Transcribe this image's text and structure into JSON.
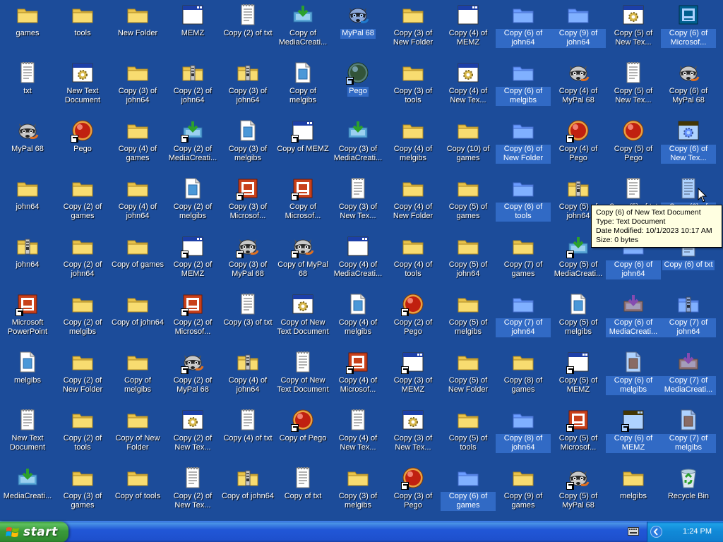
{
  "desktop": {
    "icons": [
      {
        "label": "games",
        "type": "folder",
        "col": 0,
        "row": 0
      },
      {
        "label": "tools",
        "type": "folder",
        "col": 1,
        "row": 0
      },
      {
        "label": "New Folder",
        "type": "folder",
        "col": 2,
        "row": 0
      },
      {
        "label": "MEMZ",
        "type": "window",
        "col": 3,
        "row": 0
      },
      {
        "label": "Copy (2) of txt",
        "type": "text",
        "col": 4,
        "row": 0
      },
      {
        "label": "Copy of MediaCreati...",
        "type": "media",
        "col": 5,
        "row": 0
      },
      {
        "label": "MyPal 68",
        "type": "raccoon",
        "col": 6,
        "row": 0,
        "selected": true
      },
      {
        "label": "Copy (3) of New Folder",
        "type": "folder",
        "col": 7,
        "row": 0
      },
      {
        "label": "Copy (4) of MEMZ",
        "type": "window",
        "col": 8,
        "row": 0
      },
      {
        "label": "Copy (6) of john64",
        "type": "folder",
        "col": 9,
        "row": 0,
        "selected": true
      },
      {
        "label": "Copy (9) of john64",
        "type": "folder",
        "col": 10,
        "row": 0,
        "selected": true
      },
      {
        "label": "Copy (5) of New Tex...",
        "type": "gear",
        "col": 11,
        "row": 0
      },
      {
        "label": "Copy (6) of Microsof...",
        "type": "ppt",
        "col": 12,
        "row": 0,
        "selected": true
      },
      {
        "label": "txt",
        "type": "text",
        "col": 0,
        "row": 1
      },
      {
        "label": "New Text Document",
        "type": "gear",
        "col": 1,
        "row": 1
      },
      {
        "label": "Copy (3) of john64",
        "type": "folder",
        "col": 2,
        "row": 1
      },
      {
        "label": "Copy (2) of john64",
        "type": "zip",
        "col": 3,
        "row": 1
      },
      {
        "label": "Copy (3) of john64",
        "type": "zip",
        "col": 4,
        "row": 1
      },
      {
        "label": "Copy of melgibs",
        "type": "image",
        "col": 5,
        "row": 1
      },
      {
        "label": "Pego",
        "type": "purpleball",
        "col": 6,
        "row": 1,
        "shortcut": true,
        "selected": true
      },
      {
        "label": "Copy (3) of tools",
        "type": "folder",
        "col": 7,
        "row": 1
      },
      {
        "label": "Copy (4) of New Tex...",
        "type": "gear",
        "col": 8,
        "row": 1
      },
      {
        "label": "Copy (6) of melgibs",
        "type": "folder",
        "col": 9,
        "row": 1,
        "selected": true
      },
      {
        "label": "Copy (4) of MyPal 68",
        "type": "raccoon",
        "col": 10,
        "row": 1
      },
      {
        "label": "Copy (5) of New Tex...",
        "type": "text",
        "col": 11,
        "row": 1
      },
      {
        "label": "Copy (6) of MyPal 68",
        "type": "raccoon",
        "col": 12,
        "row": 1
      },
      {
        "label": "MyPal 68",
        "type": "raccoon",
        "col": 0,
        "row": 2
      },
      {
        "label": "Pego",
        "type": "ball",
        "col": 1,
        "row": 2,
        "shortcut": true
      },
      {
        "label": "Copy (4) of games",
        "type": "folder",
        "col": 2,
        "row": 2
      },
      {
        "label": "Copy (2) of MediaCreati...",
        "type": "media",
        "col": 3,
        "row": 2,
        "shortcut": true
      },
      {
        "label": "Copy (3) of melgibs",
        "type": "image",
        "col": 4,
        "row": 2
      },
      {
        "label": "Copy of MEMZ",
        "type": "window",
        "col": 5,
        "row": 2,
        "shortcut": true
      },
      {
        "label": "Copy (3) of MediaCreati...",
        "type": "media",
        "col": 6,
        "row": 2
      },
      {
        "label": "Copy (4) of melgibs",
        "type": "folder",
        "col": 7,
        "row": 2
      },
      {
        "label": "Copy (10) of games",
        "type": "folder",
        "col": 8,
        "row": 2
      },
      {
        "label": "Copy (6) of New Folder",
        "type": "folder",
        "col": 9,
        "row": 2,
        "selected": true
      },
      {
        "label": "Copy (4) of Pego",
        "type": "ball",
        "col": 10,
        "row": 2,
        "shortcut": true
      },
      {
        "label": "Copy (5) of Pego",
        "type": "ball",
        "col": 11,
        "row": 2
      },
      {
        "label": "Copy (6) of New Tex...",
        "type": "gear",
        "col": 12,
        "row": 2,
        "selected": true
      },
      {
        "label": "john64",
        "type": "folder",
        "col": 0,
        "row": 3
      },
      {
        "label": "Copy (2) of games",
        "type": "folder",
        "col": 1,
        "row": 3
      },
      {
        "label": "Copy (4) of john64",
        "type": "folder",
        "col": 2,
        "row": 3
      },
      {
        "label": "Copy (2) of melgibs",
        "type": "image",
        "col": 3,
        "row": 3
      },
      {
        "label": "Copy (3) of Microsof...",
        "type": "ppt",
        "col": 4,
        "row": 3,
        "shortcut": true
      },
      {
        "label": "Copy of Microsof...",
        "type": "ppt",
        "col": 5,
        "row": 3,
        "shortcut": true
      },
      {
        "label": "Copy (3) of New Tex...",
        "type": "text",
        "col": 6,
        "row": 3
      },
      {
        "label": "Copy (4) of New Folder",
        "type": "folder",
        "col": 7,
        "row": 3
      },
      {
        "label": "Copy (5) of games",
        "type": "folder",
        "col": 8,
        "row": 3
      },
      {
        "label": "Copy (6) of tools",
        "type": "folder",
        "col": 9,
        "row": 3,
        "selected": true
      },
      {
        "label": "Copy (5) of john64",
        "type": "zip",
        "col": 10,
        "row": 3
      },
      {
        "label": "Copy (5) of txt",
        "type": "text",
        "col": 11,
        "row": 3
      },
      {
        "label": "Copy (6) of New Text Document",
        "type": "text",
        "col": 12,
        "row": 3,
        "selected": true
      },
      {
        "label": "john64",
        "type": "zip",
        "col": 0,
        "row": 4
      },
      {
        "label": "Copy (2) of john64",
        "type": "folder",
        "col": 1,
        "row": 4
      },
      {
        "label": "Copy of games",
        "type": "folder",
        "col": 2,
        "row": 4
      },
      {
        "label": "Copy (2) of MEMZ",
        "type": "window",
        "col": 3,
        "row": 4,
        "shortcut": true
      },
      {
        "label": "Copy (3) of MyPal 68",
        "type": "raccoon",
        "col": 4,
        "row": 4,
        "shortcut": true
      },
      {
        "label": "Copy of MyPal 68",
        "type": "raccoon",
        "col": 5,
        "row": 4,
        "shortcut": true
      },
      {
        "label": "Copy (4) of MediaCreati...",
        "type": "window",
        "col": 6,
        "row": 4
      },
      {
        "label": "Copy (4) of tools",
        "type": "folder",
        "col": 7,
        "row": 4
      },
      {
        "label": "Copy (5) of john64",
        "type": "folder",
        "col": 8,
        "row": 4
      },
      {
        "label": "Copy (7) of games",
        "type": "folder",
        "col": 9,
        "row": 4
      },
      {
        "label": "Copy (5) of MediaCreati...",
        "type": "media",
        "col": 10,
        "row": 4,
        "shortcut": true
      },
      {
        "label": "Copy (6) of john64",
        "type": "folder",
        "col": 11,
        "row": 4,
        "selected": true
      },
      {
        "label": "Copy (6) of txt",
        "type": "text",
        "col": 12,
        "row": 4,
        "selected": true
      },
      {
        "label": "Microsoft PowerPoint",
        "type": "ppt",
        "col": 0,
        "row": 5,
        "shortcut": true
      },
      {
        "label": "Copy (2) of melgibs",
        "type": "folder",
        "col": 1,
        "row": 5
      },
      {
        "label": "Copy of john64",
        "type": "folder",
        "col": 2,
        "row": 5
      },
      {
        "label": "Copy (2) of Microsof...",
        "type": "ppt",
        "col": 3,
        "row": 5,
        "shortcut": true
      },
      {
        "label": "Copy (3) of txt",
        "type": "text",
        "col": 4,
        "row": 5
      },
      {
        "label": "Copy of New Text Document",
        "type": "gear",
        "col": 5,
        "row": 5
      },
      {
        "label": "Copy (4) of melgibs",
        "type": "image",
        "col": 6,
        "row": 5
      },
      {
        "label": "Copy (2) of Pego",
        "type": "ball",
        "col": 7,
        "row": 5,
        "shortcut": true
      },
      {
        "label": "Copy (5) of melgibs",
        "type": "folder",
        "col": 8,
        "row": 5
      },
      {
        "label": "Copy (7) of john64",
        "type": "folder",
        "col": 9,
        "row": 5,
        "selected": true
      },
      {
        "label": "Copy (5) of melgibs",
        "type": "image",
        "col": 10,
        "row": 5
      },
      {
        "label": "Copy (6) of MediaCreati...",
        "type": "media",
        "col": 11,
        "row": 5,
        "selected": true
      },
      {
        "label": "Copy (7) of john64",
        "type": "zip",
        "col": 12,
        "row": 5,
        "selected": true
      },
      {
        "label": "melgibs",
        "type": "image",
        "col": 0,
        "row": 6
      },
      {
        "label": "Copy (2) of New Folder",
        "type": "folder",
        "col": 1,
        "row": 6
      },
      {
        "label": "Copy of melgibs",
        "type": "folder",
        "col": 2,
        "row": 6
      },
      {
        "label": "Copy (2) of MyPal 68",
        "type": "raccoon",
        "col": 3,
        "row": 6,
        "shortcut": true
      },
      {
        "label": "Copy (4) of john64",
        "type": "zip",
        "col": 4,
        "row": 6
      },
      {
        "label": "Copy of New Text Document",
        "type": "text",
        "col": 5,
        "row": 6
      },
      {
        "label": "Copy (4) of Microsof...",
        "type": "ppt",
        "col": 6,
        "row": 6,
        "shortcut": true
      },
      {
        "label": "Copy (3) of MEMZ",
        "type": "window",
        "col": 7,
        "row": 6,
        "shortcut": true
      },
      {
        "label": "Copy (5) of New Folder",
        "type": "folder",
        "col": 8,
        "row": 6
      },
      {
        "label": "Copy (8) of games",
        "type": "folder",
        "col": 9,
        "row": 6
      },
      {
        "label": "Copy (5) of MEMZ",
        "type": "window",
        "col": 10,
        "row": 6,
        "shortcut": true
      },
      {
        "label": "Copy (6) of melgibs",
        "type": "image",
        "col": 11,
        "row": 6,
        "selected": true
      },
      {
        "label": "Copy (7) of MediaCreati...",
        "type": "media",
        "col": 12,
        "row": 6,
        "selected": true
      },
      {
        "label": "New Text Document",
        "type": "text",
        "col": 0,
        "row": 7
      },
      {
        "label": "Copy (2) of tools",
        "type": "folder",
        "col": 1,
        "row": 7
      },
      {
        "label": "Copy of New Folder",
        "type": "folder",
        "col": 2,
        "row": 7
      },
      {
        "label": "Copy (2) of New Tex...",
        "type": "gear",
        "col": 3,
        "row": 7
      },
      {
        "label": "Copy (4) of txt",
        "type": "text",
        "col": 4,
        "row": 7
      },
      {
        "label": "Copy of Pego",
        "type": "ball",
        "col": 5,
        "row": 7,
        "shortcut": true
      },
      {
        "label": "Copy (4) of New Tex...",
        "type": "text",
        "col": 6,
        "row": 7
      },
      {
        "label": "Copy (3) of New Tex...",
        "type": "gear",
        "col": 7,
        "row": 7
      },
      {
        "label": "Copy (5) of tools",
        "type": "folder",
        "col": 8,
        "row": 7
      },
      {
        "label": "Copy (8) of john64",
        "type": "folder",
        "col": 9,
        "row": 7,
        "selected": true
      },
      {
        "label": "Copy (5) of Microsof...",
        "type": "ppt",
        "col": 10,
        "row": 7,
        "shortcut": true
      },
      {
        "label": "Copy (6) of MEMZ",
        "type": "window",
        "col": 11,
        "row": 7,
        "shortcut": true,
        "selected": true
      },
      {
        "label": "Copy (7) of melgibs",
        "type": "image",
        "col": 12,
        "row": 7,
        "selected": true
      },
      {
        "label": "MediaCreati...",
        "type": "media",
        "col": 0,
        "row": 8
      },
      {
        "label": "Copy (3) of games",
        "type": "folder",
        "col": 1,
        "row": 8
      },
      {
        "label": "Copy of tools",
        "type": "folder",
        "col": 2,
        "row": 8
      },
      {
        "label": "Copy (2) of New Tex...",
        "type": "text",
        "col": 3,
        "row": 8
      },
      {
        "label": "Copy of john64",
        "type": "zip",
        "col": 4,
        "row": 8
      },
      {
        "label": "Copy of txt",
        "type": "text",
        "col": 5,
        "row": 8
      },
      {
        "label": "Copy (3) of melgibs",
        "type": "folder",
        "col": 6,
        "row": 8
      },
      {
        "label": "Copy (3) of Pego",
        "type": "ball",
        "col": 7,
        "row": 8,
        "shortcut": true
      },
      {
        "label": "Copy (6) of games",
        "type": "folder",
        "col": 8,
        "row": 8,
        "selected": true
      },
      {
        "label": "Copy (9) of games",
        "type": "folder",
        "col": 9,
        "row": 8
      },
      {
        "label": "Copy (5) of MyPal 68",
        "type": "raccoon",
        "col": 10,
        "row": 8,
        "shortcut": true
      },
      {
        "label": "melgibs",
        "type": "folder",
        "col": 11,
        "row": 8
      },
      {
        "label": "Recycle Bin",
        "type": "recycle",
        "col": 12,
        "row": 8
      }
    ]
  },
  "tooltip": {
    "name": "Copy (6) of New Text Document",
    "type_line": "Type: Text Document",
    "modified_line": "Date Modified: 10/1/2023 10:17 AM",
    "size_line": "Size: 0 bytes"
  },
  "taskbar": {
    "start_label": "start",
    "clock": "1:24 PM"
  },
  "colors": {
    "desktop": "#1c4c9a",
    "selection": "#316ac5",
    "folder": "#f5d45e",
    "tooltip_bg": "#ffffe1"
  }
}
